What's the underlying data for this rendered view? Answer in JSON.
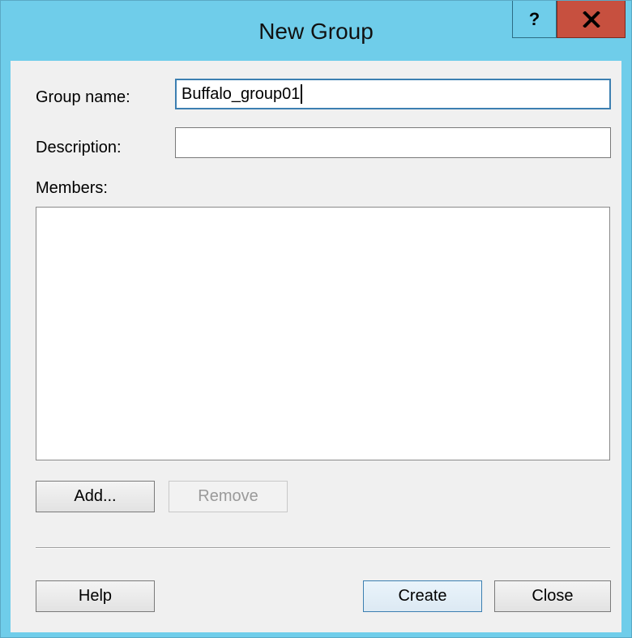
{
  "window": {
    "title": "New Group",
    "help_glyph": "?",
    "close_icon": "close-icon",
    "colors": {
      "titlebar": "#6fcdea",
      "close": "#c7503f",
      "focus": "#3c7fb1"
    }
  },
  "form": {
    "group_name_label": "Group name:",
    "group_name_value": "Buffalo_group01",
    "description_label": "Description:",
    "description_value": "",
    "members_label": "Members:",
    "members": []
  },
  "buttons": {
    "add": "Add...",
    "remove": "Remove",
    "help": "Help",
    "create": "Create",
    "close": "Close"
  }
}
